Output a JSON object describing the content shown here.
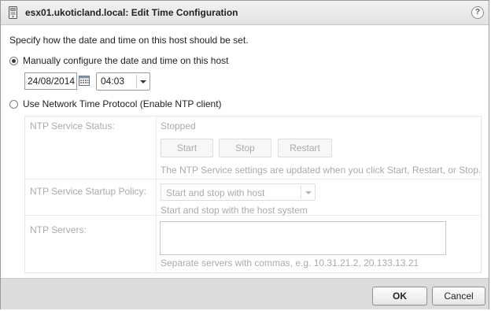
{
  "dialog": {
    "title": "esx01.ukoticland.local: Edit Time Configuration",
    "help_label": "?"
  },
  "instruction": "Specify how the date and time on this host should be set.",
  "manual": {
    "label": "Manually configure the date and time on this host",
    "selected": true,
    "date_value": "24/08/2014",
    "time_value": "04:03"
  },
  "ntp": {
    "label": "Use Network Time Protocol (Enable NTP client)",
    "selected": false,
    "service_status_label": "NTP Service Status:",
    "service_status_value": "Stopped",
    "start_label": "Start",
    "stop_label": "Stop",
    "restart_label": "Restart",
    "service_note": "The NTP Service settings are updated when you click Start, Restart, or Stop.",
    "startup_policy_label": "NTP Service Startup Policy:",
    "startup_policy_value": "Start and stop with host",
    "startup_policy_note": "Start and stop with the host system",
    "servers_label": "NTP Servers:",
    "servers_value": "",
    "servers_hint": "Separate servers with commas, e.g. 10.31.21.2, 20.133.13.21"
  },
  "footer": {
    "ok_label": "OK",
    "cancel_label": "Cancel"
  },
  "icons": {
    "title": "host-icon",
    "help": "help-icon",
    "date_picker": "calendar-icon",
    "dropdown": "chevron-down-icon"
  },
  "colors": {
    "footer_bg": "#dcdcdc",
    "disabled_text": "#aaaaaa",
    "titlebar_bg": "#e8e8e8"
  }
}
